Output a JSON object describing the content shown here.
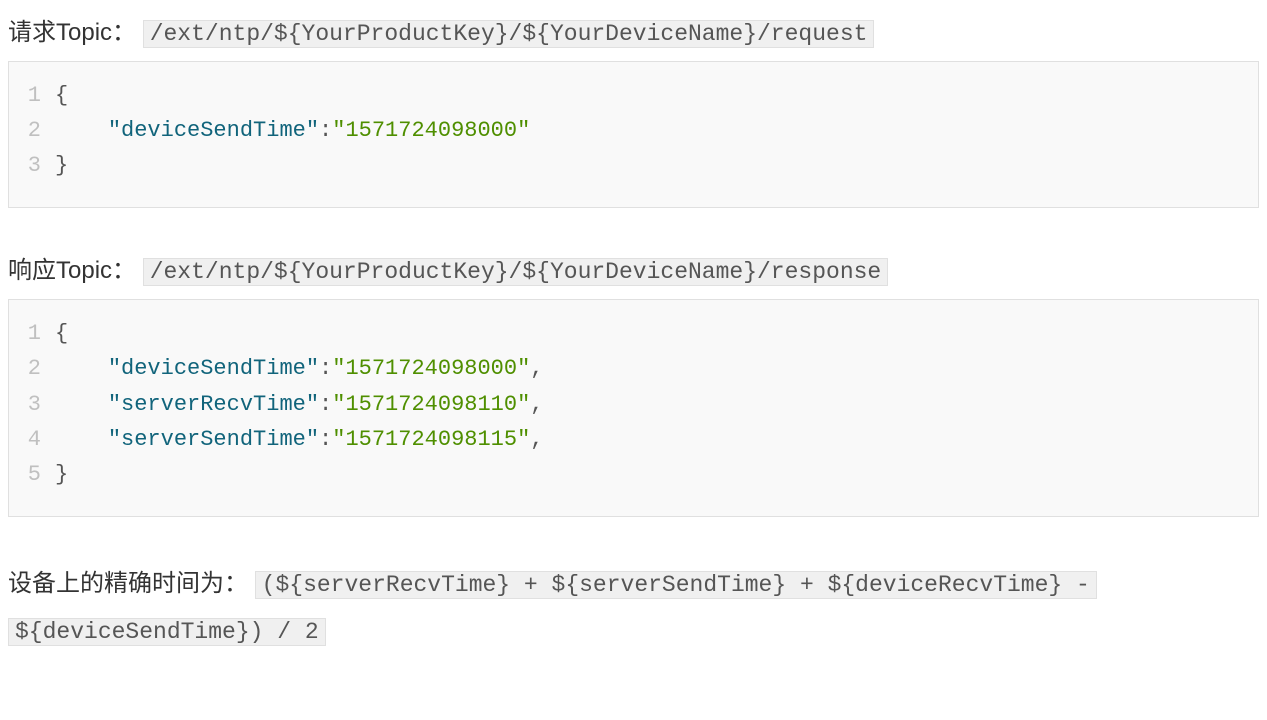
{
  "request": {
    "label": "请求Topic：",
    "topic": "/ext/ntp/${YourProductKey}/${YourDeviceName}/request",
    "code": {
      "lines": [
        {
          "n": "1",
          "segs": [
            {
              "cls": "brace",
              "t": "{"
            }
          ]
        },
        {
          "n": "2",
          "segs": [
            {
              "cls": "punct",
              "t": "    "
            },
            {
              "cls": "key",
              "t": "\"deviceSendTime\""
            },
            {
              "cls": "punct",
              "t": ":"
            },
            {
              "cls": "str",
              "t": "\"1571724098000\""
            }
          ]
        },
        {
          "n": "3",
          "segs": [
            {
              "cls": "brace",
              "t": "}"
            }
          ]
        }
      ]
    }
  },
  "response": {
    "label": "响应Topic：",
    "topic": "/ext/ntp/${YourProductKey}/${YourDeviceName}/response",
    "code": {
      "lines": [
        {
          "n": "1",
          "segs": [
            {
              "cls": "brace",
              "t": "{"
            }
          ]
        },
        {
          "n": "2",
          "segs": [
            {
              "cls": "punct",
              "t": "    "
            },
            {
              "cls": "key",
              "t": "\"deviceSendTime\""
            },
            {
              "cls": "punct",
              "t": ":"
            },
            {
              "cls": "str",
              "t": "\"1571724098000\""
            },
            {
              "cls": "punct",
              "t": ","
            }
          ]
        },
        {
          "n": "3",
          "segs": [
            {
              "cls": "punct",
              "t": "    "
            },
            {
              "cls": "key",
              "t": "\"serverRecvTime\""
            },
            {
              "cls": "punct",
              "t": ":"
            },
            {
              "cls": "str",
              "t": "\"1571724098110\""
            },
            {
              "cls": "punct",
              "t": ","
            }
          ]
        },
        {
          "n": "4",
          "segs": [
            {
              "cls": "punct",
              "t": "    "
            },
            {
              "cls": "key",
              "t": "\"serverSendTime\""
            },
            {
              "cls": "punct",
              "t": ":"
            },
            {
              "cls": "str",
              "t": "\"1571724098115\""
            },
            {
              "cls": "punct",
              "t": ","
            }
          ]
        },
        {
          "n": "5",
          "segs": [
            {
              "cls": "brace",
              "t": "}"
            }
          ]
        }
      ]
    }
  },
  "formula": {
    "label": "设备上的精确时间为：",
    "expr_part1": "(${serverRecvTime} + ${serverSendTime} + ${deviceRecvTime} -",
    "expr_part2": "${deviceSendTime}) / 2"
  }
}
